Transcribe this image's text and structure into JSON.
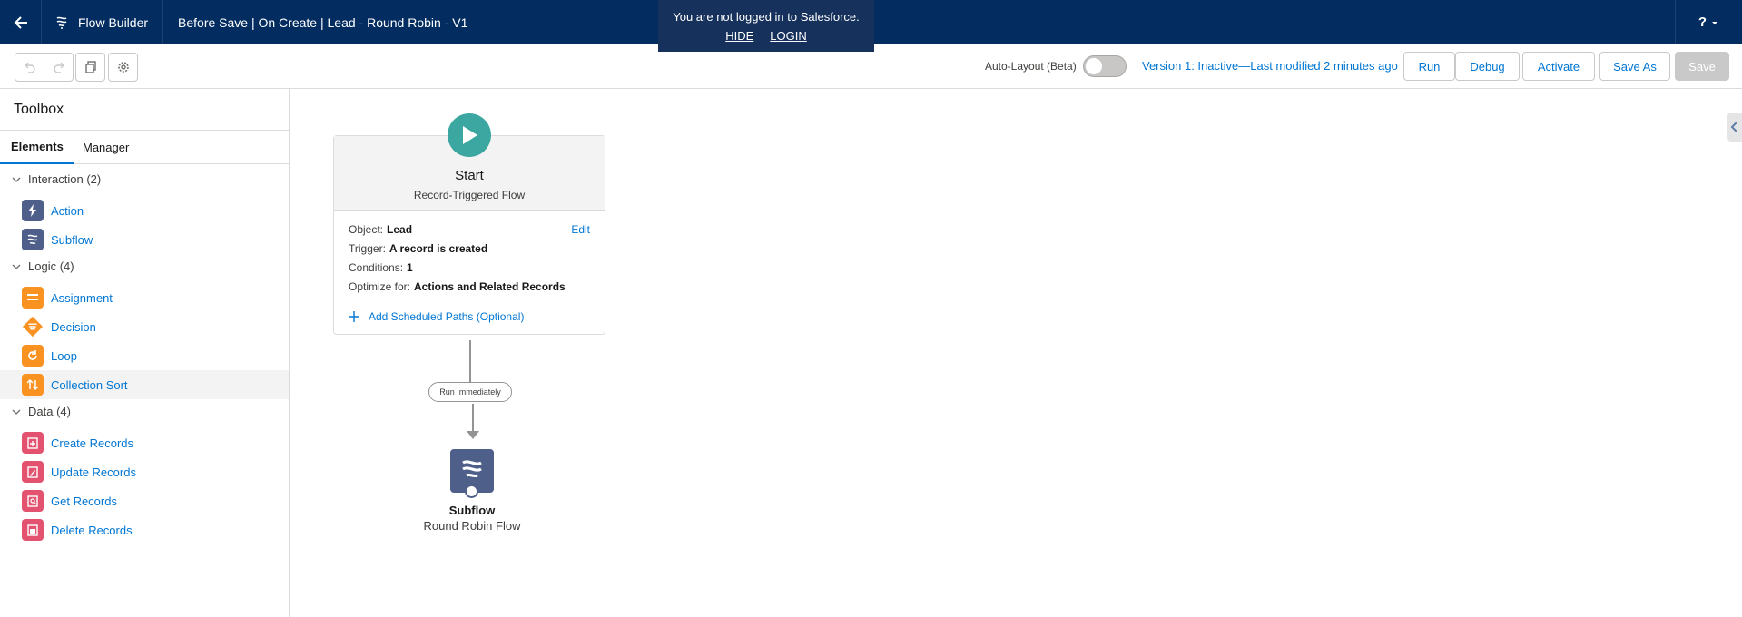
{
  "header": {
    "app_name": "Flow Builder",
    "flow_title": "Before Save | On Create | Lead - Round Robin - V1",
    "help_label": "?"
  },
  "banner": {
    "message": "You are not logged in to Salesforce.",
    "hide_label": "HIDE",
    "login_label": "LOGIN"
  },
  "toolbar": {
    "auto_layout_label": "Auto-Layout (Beta)",
    "version_text": "Version 1: Inactive—Last modified 2 minutes ago",
    "run_label": "Run",
    "debug_label": "Debug",
    "activate_label": "Activate",
    "save_as_label": "Save As",
    "save_label": "Save"
  },
  "sidebar": {
    "title": "Toolbox",
    "tabs": [
      {
        "label": "Elements"
      },
      {
        "label": "Manager"
      }
    ],
    "sections": [
      {
        "label": "Interaction (2)"
      },
      {
        "label": "Logic (4)"
      },
      {
        "label": "Data (4)"
      }
    ],
    "items": [
      {
        "label": "Action"
      },
      {
        "label": "Subflow"
      },
      {
        "label": "Assignment"
      },
      {
        "label": "Decision"
      },
      {
        "label": "Loop"
      },
      {
        "label": "Collection Sort"
      },
      {
        "label": "Create Records"
      },
      {
        "label": "Update Records"
      },
      {
        "label": "Get Records"
      },
      {
        "label": "Delete Records"
      }
    ]
  },
  "canvas": {
    "start": {
      "title": "Start",
      "subtitle": "Record-Triggered Flow",
      "edit_label": "Edit",
      "rows": [
        {
          "label": "Object:",
          "value": "Lead"
        },
        {
          "label": "Trigger:",
          "value": "A record is created"
        },
        {
          "label": "Conditions:",
          "value": "1"
        },
        {
          "label": "Optimize for:",
          "value": "Actions and Related Records"
        }
      ],
      "scheduled_paths_label": "Add Scheduled Paths (Optional)"
    },
    "connector_label": "Run Immediately",
    "subflow": {
      "type_label": "Subflow",
      "name": "Round Robin Flow"
    }
  }
}
